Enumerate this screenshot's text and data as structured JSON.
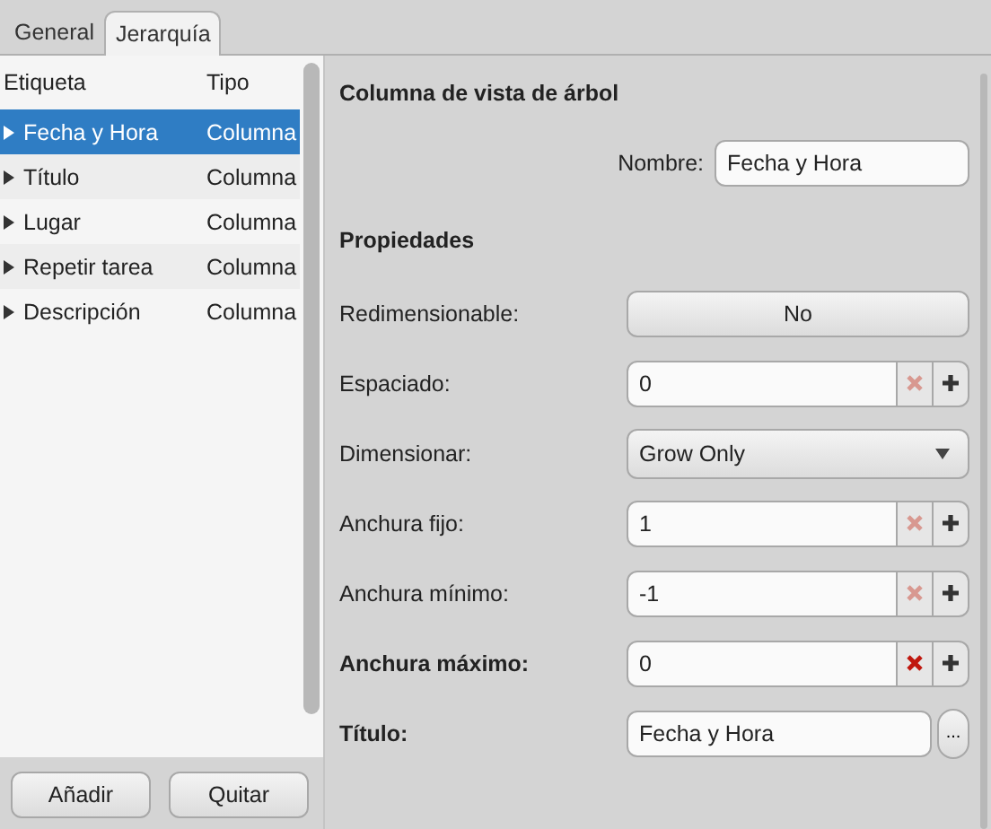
{
  "tabs": [
    {
      "label": "General",
      "selected": false
    },
    {
      "label": "Jerarquía",
      "selected": true
    }
  ],
  "tree": {
    "columns": [
      "Etiqueta",
      "Tipo"
    ],
    "rows": [
      {
        "label": "Fecha y Hora",
        "type": "Columna",
        "selected": true
      },
      {
        "label": "Título",
        "type": "Columna",
        "selected": false
      },
      {
        "label": "Lugar",
        "type": "Columna",
        "selected": false
      },
      {
        "label": "Repetir tarea",
        "type": "Columna",
        "selected": false
      },
      {
        "label": "Descripción",
        "type": "Columna",
        "selected": false
      }
    ],
    "buttons": [
      "Añadir",
      "Quitar"
    ]
  },
  "editor": {
    "title": "Columna de vista de árbol",
    "name_label": "Nombre:",
    "name_value": "Fecha y Hora",
    "section": "Propiedades",
    "properties": [
      {
        "kind": "toggle",
        "label": "Redimensionable:",
        "value": "No",
        "modified": false
      },
      {
        "kind": "spin",
        "label": "Espaciado:",
        "value": "0",
        "modified": false
      },
      {
        "kind": "combo",
        "label": "Dimensionar:",
        "value": "Grow Only",
        "modified": false
      },
      {
        "kind": "spin",
        "label": "Anchura fijo:",
        "value": "1",
        "modified": false
      },
      {
        "kind": "spin",
        "label": "Anchura mínimo:",
        "value": "-1",
        "modified": false
      },
      {
        "kind": "spin",
        "label": "Anchura máximo:",
        "value": "0",
        "modified": true
      },
      {
        "kind": "text",
        "label": "Título:",
        "value": "Fecha y Hora",
        "modified": true,
        "more": "..."
      }
    ]
  }
}
